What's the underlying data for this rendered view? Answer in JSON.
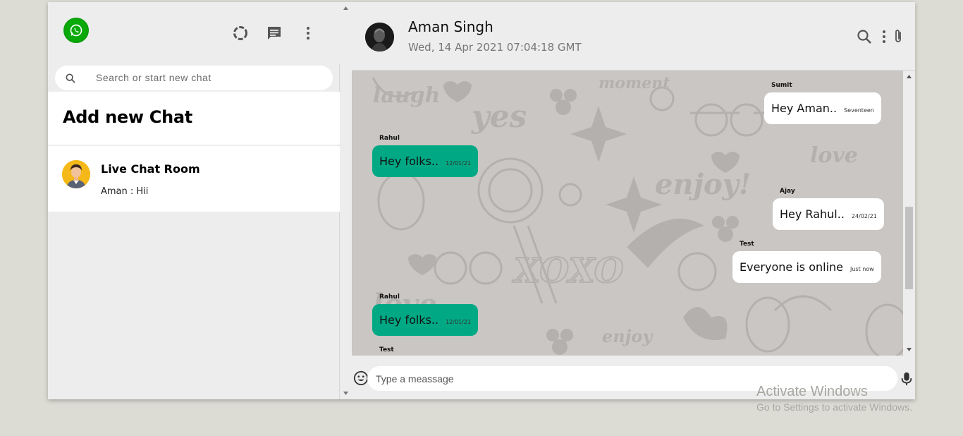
{
  "sidebar": {
    "search_placeholder": "Search or start new chat",
    "add_chat_title": "Add new Chat",
    "rooms": [
      {
        "name": "Live Chat Room",
        "last_message": "Aman : Hii"
      }
    ]
  },
  "chat": {
    "contact_name": "Aman Singh",
    "last_seen": "Wed, 14 Apr 2021 07:04:18 GMT",
    "messages": [
      {
        "sender": "Sumit",
        "text": "Hey Aman..",
        "time": "Seventeen",
        "direction": "out"
      },
      {
        "sender": "Rahul",
        "text": "Hey folks..",
        "time": "12/01/21",
        "direction": "in"
      },
      {
        "sender": "Ajay",
        "text": "Hey Rahul..",
        "time": "24/02/21",
        "direction": "out"
      },
      {
        "sender": "Test",
        "text": "Everyone is online",
        "time": "Just now",
        "direction": "out"
      },
      {
        "sender": "Rahul",
        "text": "Hey folks..",
        "time": "12/01/21",
        "direction": "in"
      },
      {
        "sender": "Test",
        "text": "",
        "time": "",
        "direction": "in"
      }
    ],
    "composer_placeholder": "Type a meassage"
  },
  "icons": {
    "logo": "whatsapp-icon",
    "status": "status-icon",
    "new_chat": "chat-icon",
    "menu": "more-vert-icon",
    "search": "search-icon",
    "attach": "attach-icon",
    "emoji": "emoji-icon",
    "mic": "mic-icon"
  },
  "colors": {
    "incoming_bubble": "#00a884",
    "outgoing_bubble": "#ffffff",
    "logo_green": "#0aa90a",
    "panel_bg": "#ededed"
  },
  "watermark": {
    "line1": "Activate Windows",
    "line2": "Go to Settings to activate Windows."
  }
}
